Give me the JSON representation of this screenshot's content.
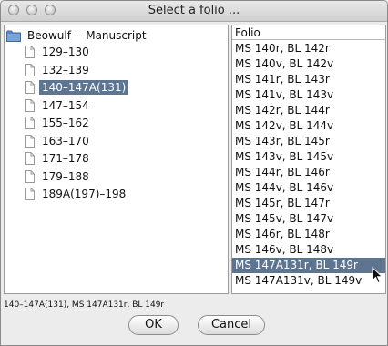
{
  "window": {
    "title": "Select a folio ..."
  },
  "tree": {
    "root_label": "Beowulf -- Manuscript",
    "items": [
      {
        "label": "129–130"
      },
      {
        "label": "132–139"
      },
      {
        "label": "140–147A(131)"
      },
      {
        "label": "147–154"
      },
      {
        "label": "155–162"
      },
      {
        "label": "163–170"
      },
      {
        "label": "171–178"
      },
      {
        "label": "179–188"
      },
      {
        "label": "189A(197)–198"
      }
    ],
    "selected_index": 2
  },
  "folio": {
    "header": "Folio",
    "items": [
      {
        "label": "MS 140r, BL 142r"
      },
      {
        "label": "MS 140v, BL 142v"
      },
      {
        "label": "MS 141r, BL 143r"
      },
      {
        "label": "MS 141v, BL 143v"
      },
      {
        "label": "MS 142r, BL 144r"
      },
      {
        "label": "MS 142v, BL 144v"
      },
      {
        "label": "MS 143r, BL 145r"
      },
      {
        "label": "MS 143v, BL 145v"
      },
      {
        "label": "MS 144r, BL 146r"
      },
      {
        "label": "MS 144v, BL 146v"
      },
      {
        "label": "MS 145r, BL 147r"
      },
      {
        "label": "MS 145v, BL 147v"
      },
      {
        "label": "MS 146r, BL 148r"
      },
      {
        "label": "MS 146v, BL 148v"
      },
      {
        "label": "MS 147A131r, BL 149r"
      },
      {
        "label": "MS 147A131v, BL 149v"
      }
    ],
    "selected_index": 14
  },
  "status_text": "140–147A(131), MS 147A131r, BL 149r",
  "buttons": {
    "ok": "OK",
    "cancel": "Cancel"
  },
  "icons": {
    "close": "close-icon",
    "minimize": "minimize-icon",
    "zoom": "zoom-icon",
    "folder": "folder-icon",
    "document": "document-icon",
    "cursor": "mouse-pointer-icon"
  },
  "colors": {
    "selection": "#5e7592",
    "folder": "#5c86c4"
  }
}
